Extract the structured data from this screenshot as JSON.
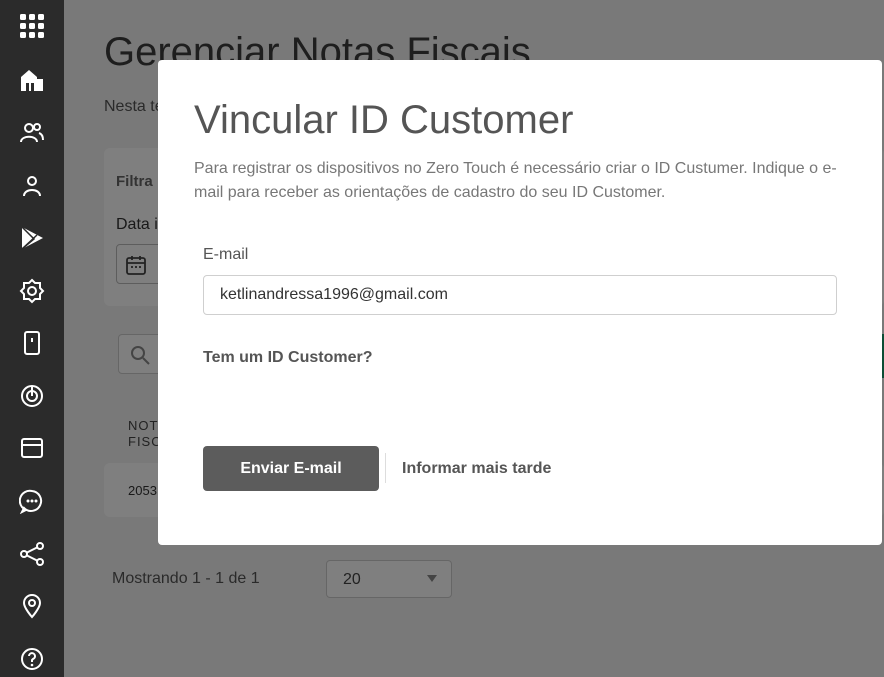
{
  "sidebar": {
    "icons": [
      "apps-grid-icon",
      "home-icon",
      "users-icon",
      "user-icon",
      "play-store-icon",
      "settings-icon",
      "device-icon",
      "power-icon",
      "browser-window-icon",
      "chat-icon",
      "share-icon",
      "location-pin-icon",
      "help-icon"
    ]
  },
  "background_page": {
    "title": "Gerenciar Notas Fiscais",
    "subtitle": "Nesta te",
    "filter_title": "Filtra",
    "date_label": "Data i",
    "column_header": "NOT FISC",
    "row_value": "2053",
    "showing_text": "Mostrando 1 - 1 de 1",
    "page_size": "20"
  },
  "modal": {
    "title": "Vincular ID Customer",
    "description": "Para registrar os dispositivos no Zero Touch é necessário criar o ID Custumer. Indique o e-mail para receber as orientações de cadastro do seu ID Customer.",
    "email_label": "E-mail",
    "email_value": "ketlinandressa1996@gmail.com",
    "link_question": "Tem um ID Customer?",
    "primary_button": "Enviar E-mail",
    "secondary_button": "Informar mais tarde"
  },
  "colors": {
    "sidebar_bg": "#2b2b2b",
    "primary_button_bg": "#5c5c5c",
    "accent_green": "#1a9a6a"
  }
}
